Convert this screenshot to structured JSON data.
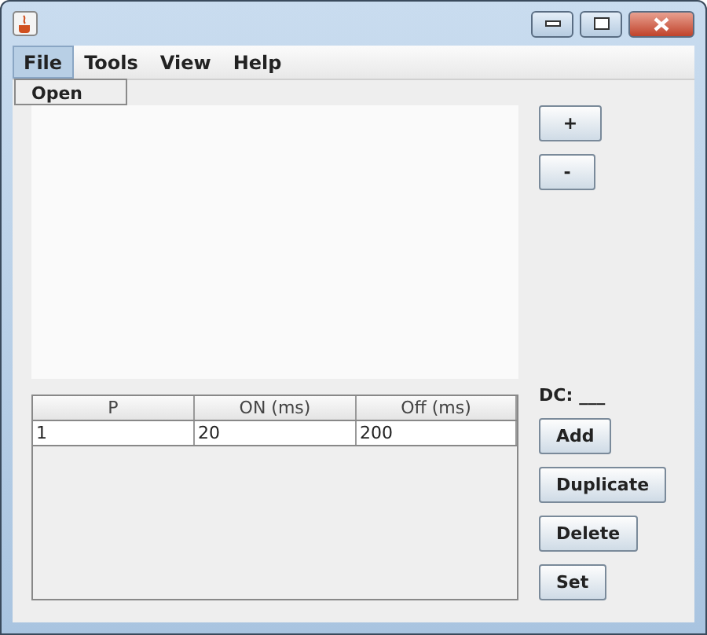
{
  "menu": [
    {
      "label": "File",
      "selected": true
    },
    {
      "label": "Tools",
      "selected": false
    },
    {
      "label": "View",
      "selected": false
    },
    {
      "label": "Help",
      "selected": false
    }
  ],
  "open_menu": {
    "items": [
      "Open"
    ]
  },
  "top_buttons": [
    "+",
    "-"
  ],
  "dc": {
    "label": "DC:",
    "value": "___"
  },
  "table": {
    "columns": [
      "P",
      "ON (ms)",
      "Off (ms)"
    ],
    "rows": [
      [
        "1",
        "20",
        "200"
      ]
    ]
  },
  "side_buttons": [
    "Add",
    "Duplicate",
    "Delete",
    "Set"
  ]
}
